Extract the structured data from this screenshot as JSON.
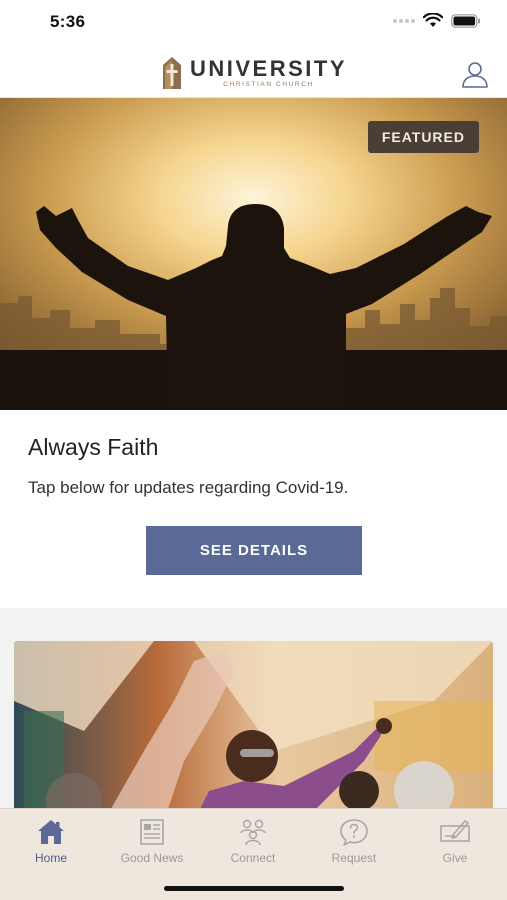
{
  "status_bar": {
    "time": "5:36",
    "icons": [
      "signal-dots-icon",
      "wifi-icon",
      "battery-icon"
    ]
  },
  "header": {
    "logo_title": "UNIVERSITY",
    "logo_subtitle": "CHRISTIAN CHURCH",
    "profile_icon": "user-profile-icon"
  },
  "featured_card": {
    "badge": "FEATURED",
    "title": "Always Faith",
    "description": "Tap below for updates regarding Covid-19.",
    "button_label": "SEE DETAILS",
    "button_color": "#5b6996"
  },
  "tabs": [
    {
      "label": "Home",
      "icon": "home-icon",
      "active": true
    },
    {
      "label": "Good News",
      "icon": "newspaper-icon",
      "active": false
    },
    {
      "label": "Connect",
      "icon": "people-icon",
      "active": false
    },
    {
      "label": "Request",
      "icon": "question-bubble-icon",
      "active": false
    },
    {
      "label": "Give",
      "icon": "check-pen-icon",
      "active": false
    }
  ],
  "colors": {
    "accent": "#5b6996",
    "tab_bar_bg": "#efe6de",
    "badge_bg": "#4a3f34"
  }
}
